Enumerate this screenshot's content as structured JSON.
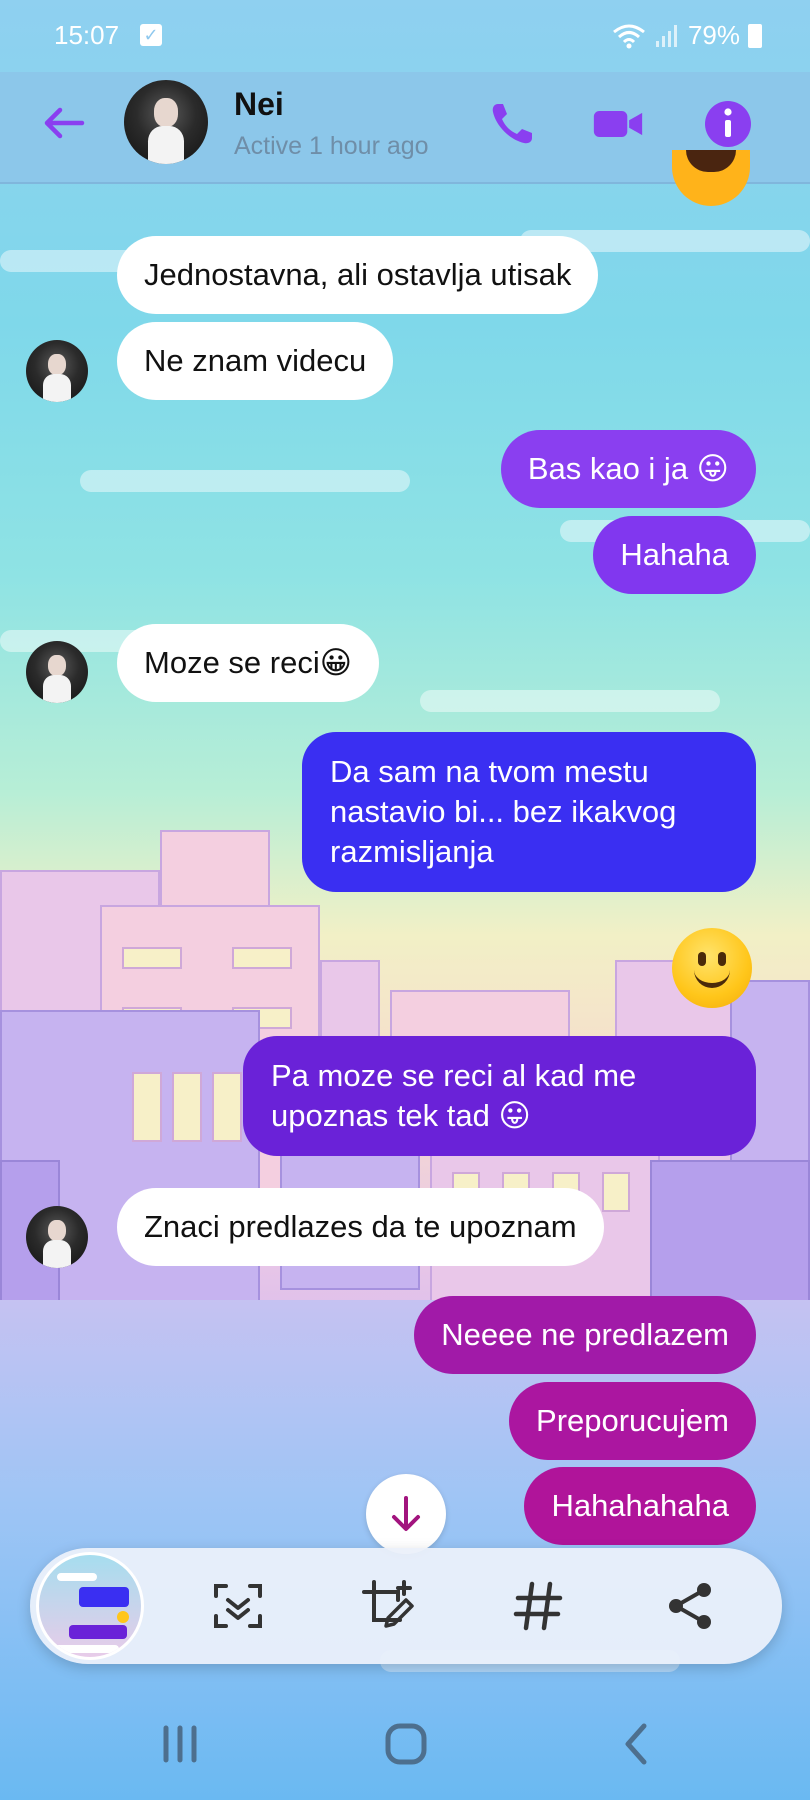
{
  "status_bar": {
    "time": "15:07",
    "battery": "79%",
    "icons": [
      "checkbox-icon",
      "wifi-icon",
      "signal-icon",
      "battery-icon"
    ]
  },
  "header": {
    "contact_name": "Nei",
    "status": "Active 1 hour ago",
    "icons": [
      "back-arrow-icon",
      "phone-icon",
      "video-icon",
      "info-icon"
    ],
    "accent_color": "#8a3ff0"
  },
  "messages": [
    {
      "side": "in",
      "text": "Jednostavna, ali ostavlja utisak"
    },
    {
      "side": "in",
      "text": "Ne znam videcu"
    },
    {
      "side": "out",
      "text": "Bas kao i ja 😛"
    },
    {
      "side": "out",
      "text": "Hahaha"
    },
    {
      "side": "in",
      "text": "Moze se reci😀"
    },
    {
      "side": "out",
      "text": "Da sam na tvom mestu nastavio bi... bez ikakvog razmisljanja"
    },
    {
      "side": "out",
      "text": "🙂",
      "type": "emoji"
    },
    {
      "side": "out",
      "text": "Pa moze se reci al kad me upoznas tek tad 😛"
    },
    {
      "side": "in",
      "text": "Znaci predlazes da te upoznam"
    },
    {
      "side": "out",
      "text": "Neeee ne predlazem"
    },
    {
      "side": "out",
      "text": "Preporucujem"
    },
    {
      "side": "out",
      "text": "Hahahahaha"
    }
  ],
  "bubble_colors": {
    "incoming": "#ffffff",
    "out_top": "#8a3ff0",
    "out_mid": "#3a2ff2",
    "out_lower": "#6a22d8",
    "out_bottom": "#b0149a"
  },
  "screenshot_toolbar": {
    "icons": [
      "screenshot-thumbnail",
      "scan-icon",
      "edit-crop-icon",
      "hashtag-icon",
      "share-icon"
    ]
  },
  "nav_bar": {
    "icons": [
      "recent-apps-icon",
      "home-icon",
      "back-icon"
    ]
  }
}
